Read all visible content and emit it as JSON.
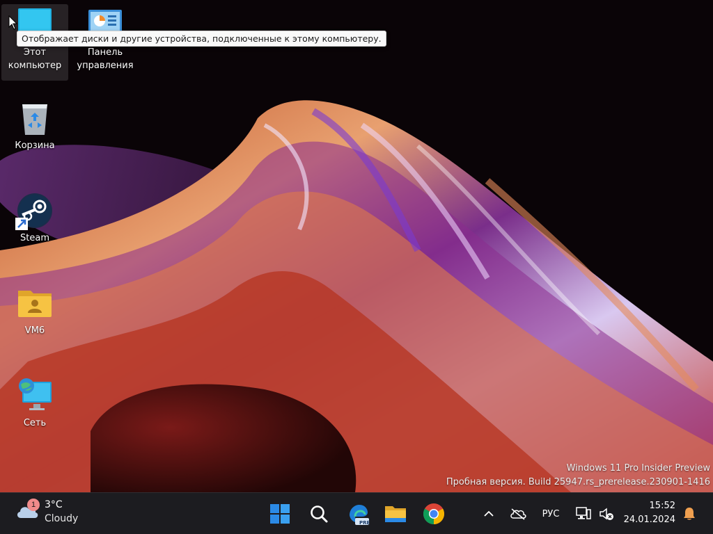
{
  "desktop": {
    "icons": [
      {
        "label": "Этот компьютер",
        "icon": "this-pc-icon"
      },
      {
        "label": "Панель управления",
        "icon": "control-panel-icon"
      },
      {
        "label": "Корзина",
        "icon": "recycle-bin-icon"
      },
      {
        "label": "Steam",
        "icon": "steam-icon"
      },
      {
        "label": "VM6",
        "icon": "user-folder-icon"
      },
      {
        "label": "Сеть",
        "icon": "network-icon"
      }
    ],
    "tooltip": "Отображает диски и другие устройства, подключенные к этому компьютеру.",
    "watermark": {
      "line1": "Windows 11 Pro Insider Preview",
      "line2": "Пробная версия. Build 25947.rs_prerelease.230901-1416"
    }
  },
  "taskbar": {
    "weather": {
      "badge": "1",
      "temperature": "3°C",
      "condition": "Cloudy"
    },
    "apps": [
      {
        "name": "start-button",
        "icon": "windows-logo-icon"
      },
      {
        "name": "search-button",
        "icon": "search-icon"
      },
      {
        "name": "edge-preview-button",
        "icon": "edge-icon",
        "badge": "PRE"
      },
      {
        "name": "file-explorer-button",
        "icon": "folder-icon"
      },
      {
        "name": "chrome-button",
        "icon": "chrome-icon"
      }
    ],
    "tray": {
      "language": "РУС",
      "time": "15:52",
      "date": "24.01.2024"
    }
  },
  "colors": {
    "taskbar_bg": "#1c1c20",
    "weather_badge": "#f08b8b",
    "folder_yellow": "#f6c343",
    "windows_blue": "#2b8ae6"
  }
}
